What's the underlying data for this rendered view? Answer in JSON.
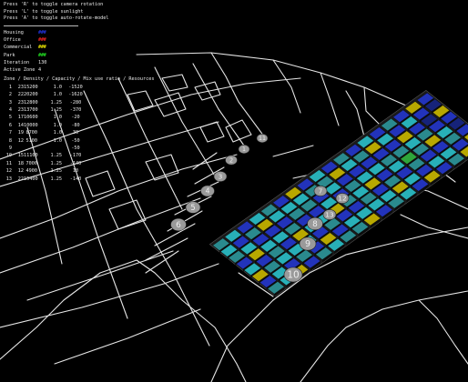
{
  "instructions": [
    "Press 'R' to toggle camera rotation",
    "Press 'L' to toggle sunlight",
    "Press 'A' to toggle auto-rotate-model"
  ],
  "legend": [
    {
      "label": "Housing",
      "swatch": "###",
      "color": "#2233dd"
    },
    {
      "label": "Office",
      "swatch": "###",
      "color": "#ee2222"
    },
    {
      "label": "Commercial",
      "swatch": "###",
      "color": "#e8e000"
    },
    {
      "label": "Park",
      "swatch": "###",
      "color": "#22dd22"
    }
  ],
  "stats": [
    {
      "label": "Iteration",
      "value": "130"
    },
    {
      "label": "Active Zone",
      "value": "4"
    }
  ],
  "zone_table": {
    "header": "Zone / Density / Capacity / Mix use ratio / Resources",
    "rows": [
      [
        "1",
        "23",
        "15200",
        "1.0",
        "-1520"
      ],
      [
        "2",
        "22",
        "20200",
        "1.0",
        "-1620"
      ],
      [
        "3",
        "23",
        "12800",
        "1.25",
        "-280"
      ],
      [
        "4",
        "23",
        "13700",
        "1.25",
        "-370"
      ],
      [
        "5",
        "17",
        "10600",
        "1.0",
        "-20"
      ],
      [
        "6",
        "14",
        "10000",
        "1.0",
        "-80"
      ],
      [
        "7",
        "19",
        "8700",
        "1.0",
        "30"
      ],
      [
        "8",
        "12",
        "5100",
        "1.0",
        "-50"
      ],
      [
        "9",
        "",
        "",
        "",
        "-50"
      ],
      [
        "10",
        "15",
        "11100",
        "1.25",
        "-170"
      ],
      [
        "11",
        "18",
        "7000",
        "1.25",
        "-140"
      ],
      [
        "12",
        "12",
        "4900",
        "1.25",
        "10"
      ],
      [
        "13",
        "22",
        "15400",
        "1.25",
        "-140"
      ]
    ]
  },
  "scene": {
    "zone_markers": [
      "1",
      "2",
      "3",
      "4",
      "5",
      "6",
      "7",
      "8",
      "9",
      "10",
      "11",
      "12",
      "13"
    ],
    "colors": {
      "road": "#e6e6e6",
      "background": "#000000"
    }
  }
}
